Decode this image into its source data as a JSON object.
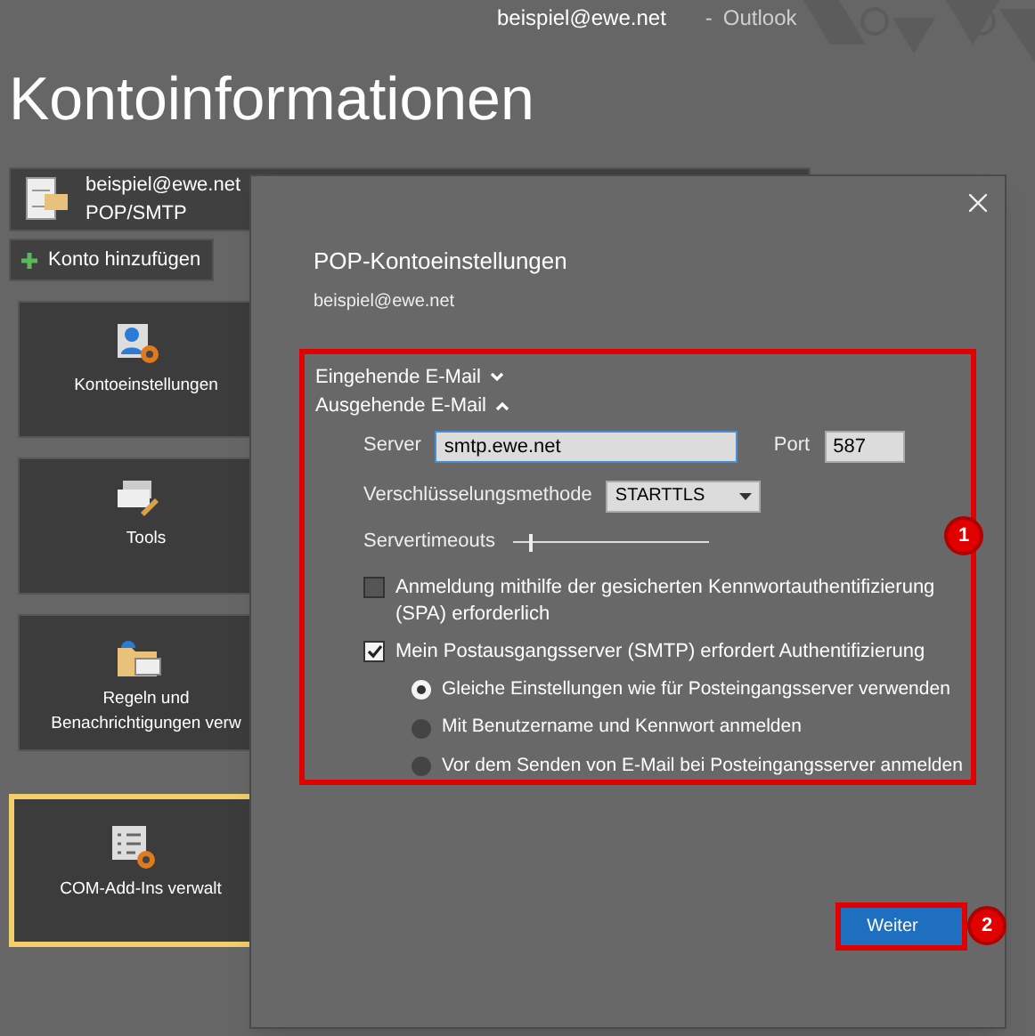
{
  "window": {
    "user": "beispiel@ewe.net",
    "separator": "-",
    "app": "Outlook"
  },
  "page_title": "Kontoinformationen",
  "account": {
    "email": "beispiel@ewe.net",
    "type": "POP/SMTP"
  },
  "add_account_button": {
    "label": "Konto hinzufügen"
  },
  "tiles": [
    {
      "lines": [
        "Kontoeinstellungen"
      ],
      "selected": false
    },
    {
      "lines": [
        "Tools"
      ],
      "selected": false
    },
    {
      "lines": [
        "Regeln und",
        "Benachrichtigungen verw"
      ],
      "selected": false
    },
    {
      "lines": [
        "COM-Add-Ins verwalt"
      ],
      "selected": true
    }
  ],
  "dialog": {
    "title": "POP-Kontoeinstellungen",
    "email": "beispiel@ewe.net",
    "sections": [
      {
        "label": "Eingehende E-Mail",
        "expanded": false
      },
      {
        "label": "Ausgehende E-Mail",
        "expanded": true
      }
    ],
    "server": {
      "label": "Server",
      "value": "smtp.ewe.net"
    },
    "port": {
      "label": "Port",
      "value": "587"
    },
    "encryption": {
      "label": "Verschlüsselungsmethode",
      "value": "STARTTLS"
    },
    "timeout": {
      "label": "Servertimeouts",
      "level": 0.08
    },
    "checkboxes": [
      {
        "label": "Anmeldung mithilfe der gesicherten Kennwortauthentifizierung (SPA) erforderlich",
        "checked": false
      },
      {
        "label": "Mein Postausgangsserver (SMTP) erfordert Authentifizierung",
        "checked": true
      }
    ],
    "radios": [
      {
        "label": "Gleiche Einstellungen wie für Posteingangsserver verwenden",
        "selected": true
      },
      {
        "label": "Mit Benutzername und Kennwort anmelden",
        "selected": false
      },
      {
        "label": "Vor dem Senden von E-Mail bei Posteingangsserver anmelden",
        "selected": false
      }
    ],
    "next_button": {
      "label": "Weiter"
    }
  },
  "annotations": [
    "1",
    "2"
  ]
}
